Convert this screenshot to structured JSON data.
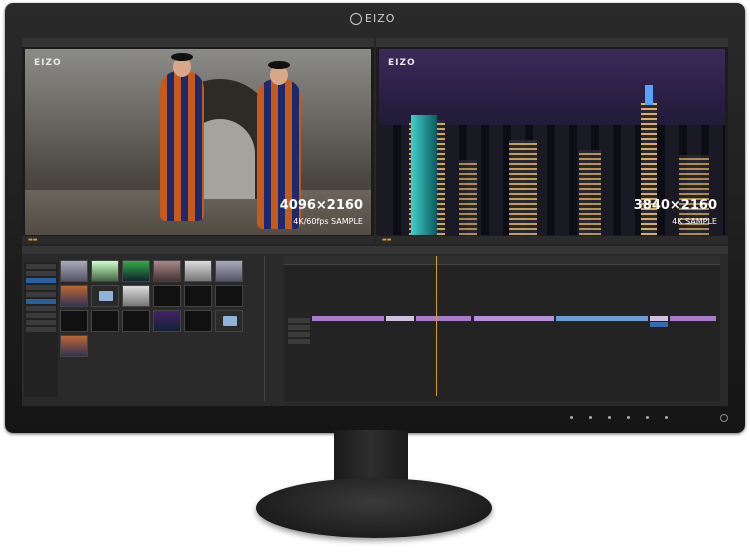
{
  "monitor": {
    "brand": "EIZO"
  },
  "source_viewer": {
    "watermark": "EIZO",
    "resolution": "4096×2160",
    "caption": "4K/60fps SAMPLE"
  },
  "program_viewer": {
    "watermark": "EIZO",
    "resolution": "3840×2160",
    "caption": "4K SAMPLE"
  }
}
